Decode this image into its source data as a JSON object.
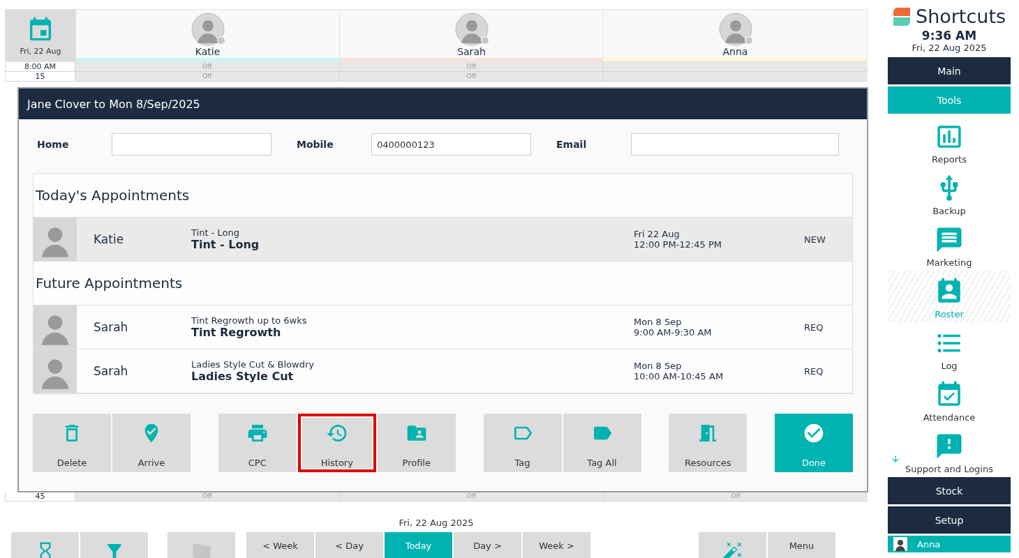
{
  "schedule": {
    "date": "Fri, 22 Aug",
    "staff": [
      {
        "name": "Katie",
        "color": "#c8f7f7"
      },
      {
        "name": "Sarah",
        "color": "#fde0dc"
      },
      {
        "name": "Anna",
        "color": "#fdf8d4"
      }
    ],
    "rows": [
      {
        "time": "8:00 AM",
        "cells": [
          "Off",
          "Off",
          ""
        ]
      },
      {
        "time": "15",
        "cells": [
          "Off",
          "Off",
          ""
        ]
      },
      {
        "time": "45",
        "cells": [
          "Off",
          "Off",
          "Off"
        ]
      }
    ]
  },
  "dialog": {
    "title": "Jane Clover to Mon 8/Sep/2025",
    "fields": [
      {
        "label": "Home"
      },
      {
        "label": "Mobile",
        "value": "0400000123"
      },
      {
        "label": "Email"
      }
    ],
    "sections": [
      {
        "title": "Today's Appointments",
        "appointments": [
          {
            "staff": "Katie",
            "service_full": "Tint - Long",
            "service": "Tint - Long",
            "date": "Fri 22 Aug",
            "time": "12:00 PM-12:45 PM",
            "status": "NEW",
            "selected": true
          }
        ]
      },
      {
        "title": "Future Appointments",
        "appointments": [
          {
            "staff": "Sarah",
            "service_full": "Tint Regrowth up to 6wks",
            "service": "Tint Regrowth",
            "date": "Mon 8 Sep",
            "time": "9:00 AM-9:30 AM",
            "status": "REQ",
            "selected": false
          },
          {
            "staff": "Sarah",
            "service_full": "Ladies Style Cut & Blowdry",
            "service": "Ladies Style Cut",
            "date": "Mon 8 Sep",
            "time": "10:00 AM-10:45 AM",
            "status": "REQ",
            "selected": false
          }
        ]
      }
    ],
    "button_groups": [
      [
        {
          "label": "Delete",
          "highlighted": false,
          "primary": false
        },
        {
          "label": "Arrive",
          "highlighted": false,
          "primary": false
        }
      ],
      [
        {
          "label": "CPC",
          "highlighted": false,
          "primary": false
        },
        {
          "label": "History",
          "highlighted": true,
          "primary": false
        },
        {
          "label": "Profile",
          "highlighted": false,
          "primary": false
        }
      ],
      [
        {
          "label": "Tag",
          "highlighted": false,
          "primary": false
        },
        {
          "label": "Tag All",
          "highlighted": false,
          "primary": false
        }
      ],
      [
        {
          "label": "Resources",
          "highlighted": false,
          "primary": false
        }
      ],
      [
        {
          "label": "Done",
          "highlighted": false,
          "primary": true
        }
      ]
    ]
  },
  "footer": {
    "date": "Fri, 22 Aug 2025",
    "buttons": [
      {
        "kind": "icon",
        "disabled": false,
        "selected": false
      },
      {
        "kind": "icon",
        "disabled": false,
        "selected": false
      },
      {
        "kind": "icon",
        "disabled": true,
        "selected": false
      },
      {
        "kind": "text",
        "label": "< Week",
        "disabled": false,
        "selected": false
      },
      {
        "kind": "text",
        "label": "< Day",
        "disabled": false,
        "selected": false
      },
      {
        "kind": "text",
        "label": "Today",
        "disabled": false,
        "selected": true
      },
      {
        "kind": "text",
        "label": "Day >",
        "disabled": false,
        "selected": false
      },
      {
        "kind": "text",
        "label": "Week >",
        "disabled": false,
        "selected": false
      },
      {
        "kind": "icon",
        "disabled": false,
        "selected": false
      },
      {
        "kind": "text",
        "label": "Menu",
        "disabled": false,
        "selected": false
      }
    ]
  },
  "sidebar": {
    "brand": "Shortcuts",
    "time": "9:36 AM",
    "date": "Fri, 22 Aug 2025",
    "items": [
      {
        "kind": "section",
        "label": "Main",
        "selected": false
      },
      {
        "kind": "section",
        "label": "Tools",
        "selected": true
      },
      {
        "kind": "tool",
        "label": "Reports",
        "selected": false
      },
      {
        "kind": "tool",
        "label": "Backup",
        "selected": false
      },
      {
        "kind": "tool",
        "label": "Marketing",
        "selected": false
      },
      {
        "kind": "tool",
        "label": "Roster",
        "selected": true
      },
      {
        "kind": "tool",
        "label": "Log",
        "selected": false
      },
      {
        "kind": "tool",
        "label": "Attendance",
        "selected": false
      },
      {
        "kind": "tool",
        "label": "Support and Logins",
        "selected": false,
        "more_below": true
      },
      {
        "kind": "section",
        "label": "Stock",
        "selected": false
      },
      {
        "kind": "section",
        "label": "Setup",
        "selected": false
      },
      {
        "kind": "user",
        "label": "Anna",
        "selected": true
      }
    ]
  }
}
